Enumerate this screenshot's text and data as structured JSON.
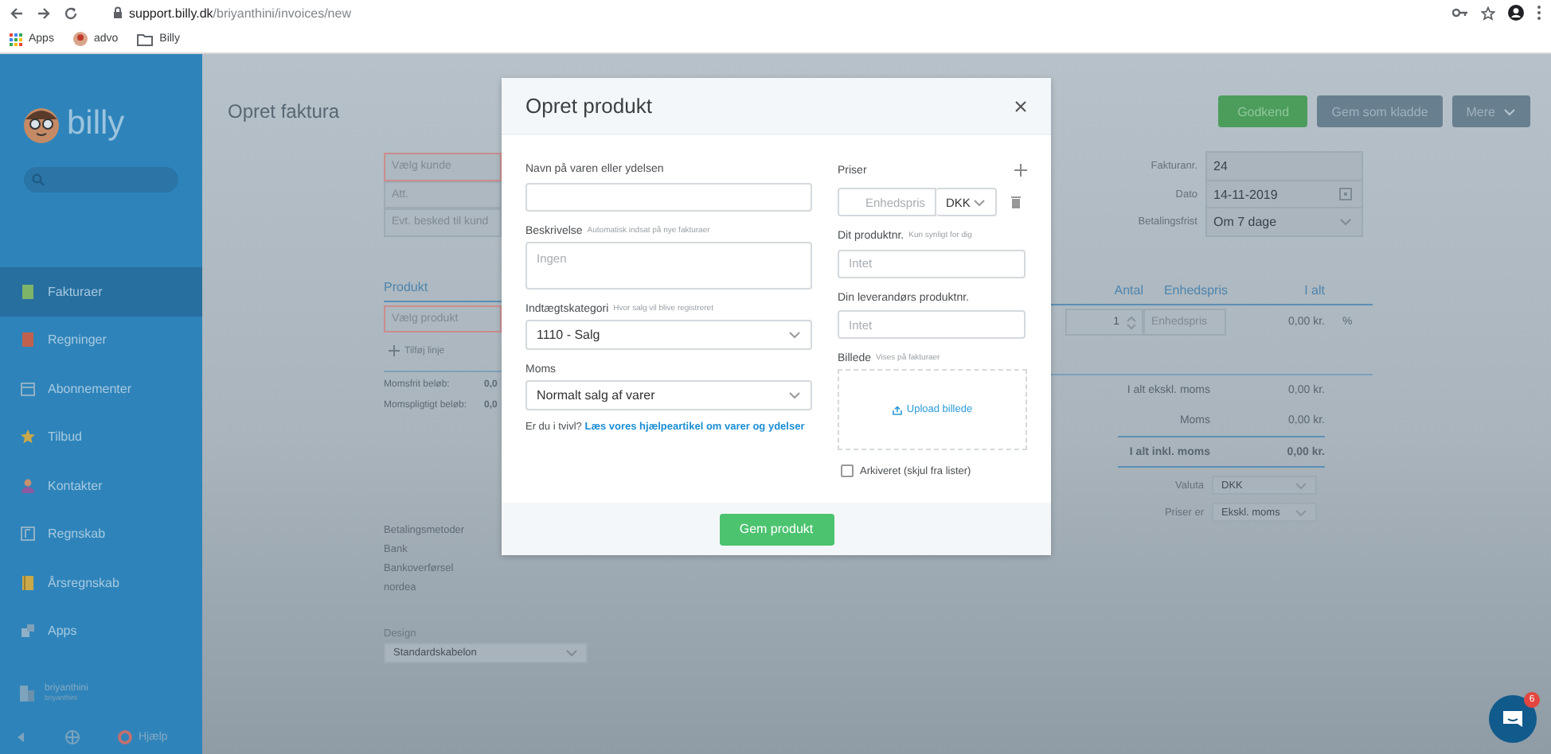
{
  "browser": {
    "url_host": "support.billy.dk",
    "url_path": "/briyanthini/invoices/new",
    "bookmarks": [
      {
        "label": "Apps",
        "kind": "apps"
      },
      {
        "label": "advo",
        "kind": "avatar"
      },
      {
        "label": "Billy",
        "kind": "folder"
      }
    ]
  },
  "sidebar": {
    "logo": "billy",
    "items": [
      {
        "label": "Fakturaer",
        "selected": true
      },
      {
        "label": "Regninger",
        "selected": false
      },
      {
        "label": "Abonnementer",
        "selected": false
      },
      {
        "label": "Tilbud",
        "selected": false
      },
      {
        "label": "Kontakter",
        "selected": false
      },
      {
        "label": "Regnskab",
        "selected": false
      },
      {
        "label": "Årsregnskab",
        "selected": false
      },
      {
        "label": "Apps",
        "selected": false
      }
    ],
    "account": {
      "name": "briyanthini",
      "role": "briyanthini"
    },
    "help": "Hjælp"
  },
  "invoice": {
    "title": "Opret faktura",
    "actions": [
      {
        "label": "Godkend",
        "kind": "primary"
      },
      {
        "label": "Gem som kladde",
        "kind": "secondary"
      },
      {
        "label": "Mere",
        "kind": "dropdown"
      }
    ],
    "customer_fields": [
      {
        "placeholder": "Vælg kunde",
        "invalid": true
      },
      {
        "placeholder": "Att.",
        "invalid": false
      },
      {
        "placeholder": "Evt. besked til kund",
        "invalid": false
      }
    ],
    "product_header": "Produkt",
    "product_field": {
      "placeholder": "Vælg produkt",
      "invalid": true
    },
    "add_line": "Tilføj linje",
    "subtotals": [
      {
        "label": "Momsfrit beløb:",
        "value": "0,0"
      },
      {
        "label": "Momspligtigt beløb:",
        "value": "0,0"
      }
    ],
    "payment": {
      "title": "Betalingsmetoder",
      "items": [
        "Bank",
        "Bankoverførsel",
        "nordea"
      ]
    },
    "design": {
      "label": "Design",
      "value": "Standardskabelon"
    },
    "meta": [
      {
        "label": "Fakturanr.",
        "value": "24",
        "kind": "text"
      },
      {
        "label": "Dato",
        "value": "14-11-2019",
        "kind": "date"
      },
      {
        "label": "Betalingsfrist",
        "value": "Om 7 dage",
        "kind": "select"
      }
    ],
    "columns": [
      "Antal",
      "Enhedspris",
      "I alt"
    ],
    "line": {
      "quantity": "1",
      "price_placeholder": "Enhedspris",
      "total": "0,00 kr.",
      "discount": "%"
    },
    "totals": [
      {
        "label": "I alt ekskl. moms",
        "value": "0,00 kr.",
        "emphasis": false
      },
      {
        "label": "Moms",
        "value": "0,00 kr.",
        "emphasis": false
      },
      {
        "label": "I alt inkl. moms",
        "value": "0,00 kr.",
        "emphasis": true
      }
    ],
    "settings": [
      {
        "label": "Valuta",
        "value": "DKK"
      },
      {
        "label": "Priser er",
        "value": "Ekskl. moms"
      }
    ]
  },
  "modal": {
    "title": "Opret produkt",
    "left": [
      {
        "kind": "input",
        "label": "Navn på varen eller ydelsen"
      },
      {
        "kind": "textarea",
        "label": "Beskrivelse",
        "hint": "Automatisk indsat på nye fakturaer",
        "placeholder": "Ingen"
      },
      {
        "kind": "select",
        "label": "Indtægtskategori",
        "hint": "Hvor salg vil blive registreret",
        "value": "1110 - Salg"
      },
      {
        "kind": "select",
        "label": "Moms",
        "value": "Normalt salg af varer"
      }
    ],
    "help": {
      "text": "Er du i tvivl?",
      "link": "Læs vores hjælpeartikel om varer og ydelser"
    },
    "right": [
      {
        "kind": "price",
        "label": "Priser",
        "placeholder": "Enhedspris",
        "value": "DKK"
      },
      {
        "kind": "input",
        "label": "Dit produktnr.",
        "hint": "Kun synligt for dig",
        "placeholder": "Intet"
      },
      {
        "kind": "input",
        "label": "Din leverandørs produktnr.",
        "placeholder": "Intet"
      },
      {
        "kind": "upload",
        "label": "Billede",
        "hint": "Vises på fakturaer",
        "value": "Upload billede"
      },
      {
        "kind": "checkbox",
        "label": "Arkiveret (skjul fra lister)",
        "checked": false
      }
    ],
    "submit": "Gem produkt"
  },
  "chat": {
    "badge": "6"
  }
}
